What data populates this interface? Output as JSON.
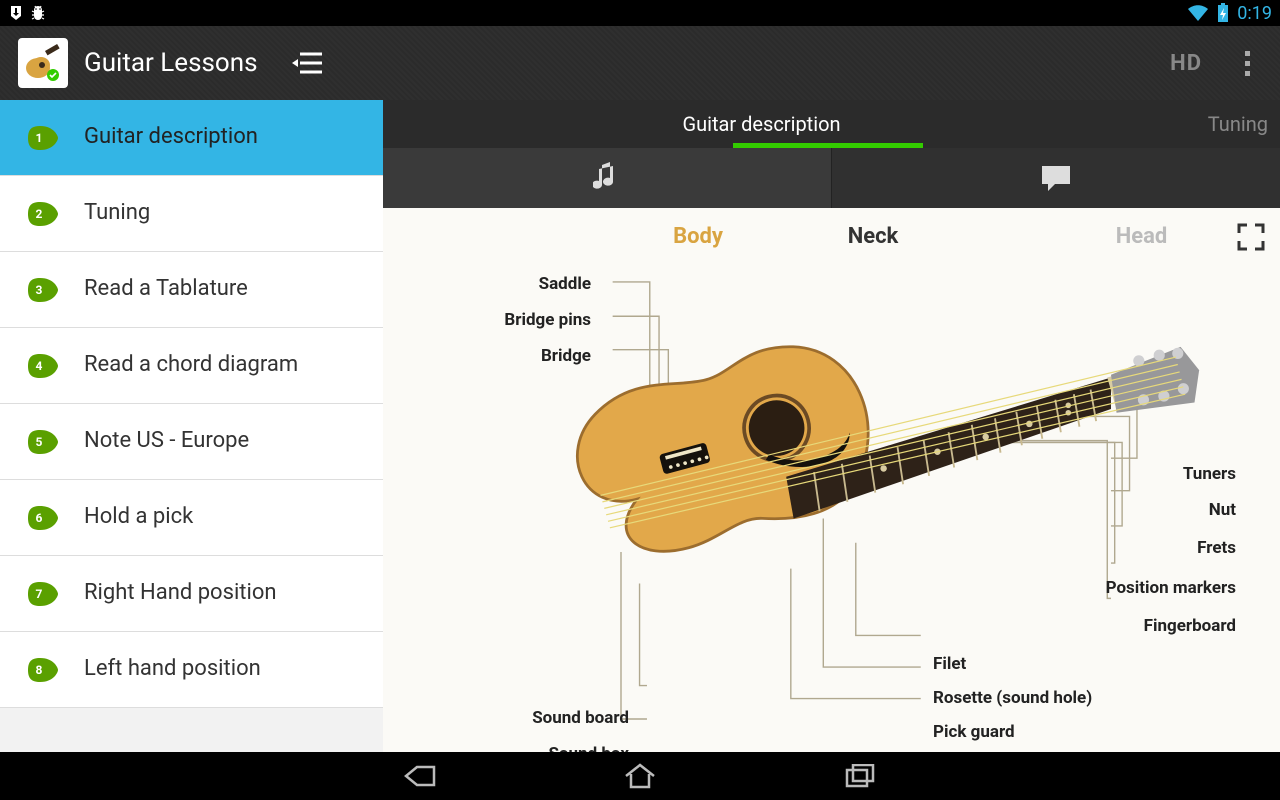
{
  "statusbar": {
    "time": "0:19"
  },
  "actionbar": {
    "title": "Guitar Lessons",
    "hd_label": "HD"
  },
  "sidebar": {
    "items": [
      {
        "num": "1",
        "label": "Guitar description",
        "active": true
      },
      {
        "num": "2",
        "label": "Tuning"
      },
      {
        "num": "3",
        "label": "Read a Tablature"
      },
      {
        "num": "4",
        "label": "Read a chord diagram"
      },
      {
        "num": "5",
        "label": "Note US - Europe"
      },
      {
        "num": "6",
        "label": "Hold a pick"
      },
      {
        "num": "7",
        "label": "Right Hand position"
      },
      {
        "num": "8",
        "label": "Left hand position"
      }
    ]
  },
  "content_tabs": {
    "items": [
      {
        "label": "Guitar description",
        "active": true
      },
      {
        "label": "Tuning"
      }
    ]
  },
  "diagram": {
    "sections": {
      "body": "Body",
      "neck": "Neck",
      "head": "Head"
    },
    "parts": {
      "saddle": "Saddle",
      "bridge_pins": "Bridge pins",
      "bridge": "Bridge",
      "sound_board": "Sound board",
      "sound_box": "Sound box",
      "tuners": "Tuners",
      "nut": "Nut",
      "frets": "Frets",
      "position_markers": "Position markers",
      "fingerboard": "Fingerboard",
      "filet": "Filet",
      "rosette": "Rosette (sound hole)",
      "pick_guard": "Pick guard"
    }
  }
}
